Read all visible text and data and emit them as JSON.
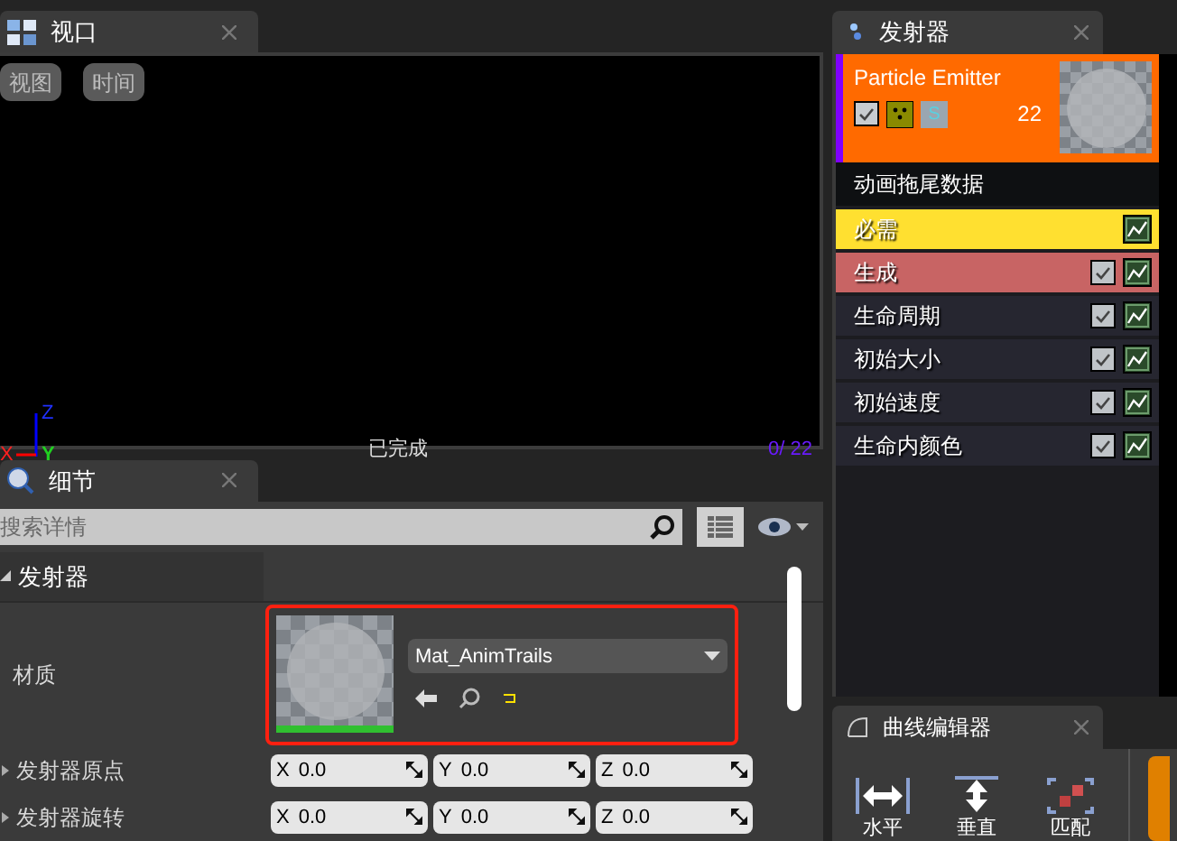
{
  "viewport_tab": {
    "title": "视口"
  },
  "viewport": {
    "buttons": [
      "视图",
      "时间"
    ],
    "axes": {
      "x": "X",
      "y": "Y",
      "z": "Z"
    },
    "status": "已完成",
    "counter": "0/ 22"
  },
  "details_tab": {
    "title": "细节"
  },
  "search": {
    "placeholder": "搜索详情"
  },
  "category": "发射器",
  "material": {
    "label": "材质",
    "value": "Mat_AnimTrails"
  },
  "vector_rows": [
    {
      "label": "发射器原点",
      "fields": [
        {
          "axis": "X",
          "value": "0.0"
        },
        {
          "axis": "Y",
          "value": "0.0"
        },
        {
          "axis": "Z",
          "value": "0.0"
        }
      ]
    },
    {
      "label": "发射器旋转",
      "fields": [
        {
          "axis": "X",
          "value": "0.0"
        },
        {
          "axis": "Y",
          "value": "0.0"
        },
        {
          "axis": "Z",
          "value": "0.0"
        }
      ]
    }
  ],
  "emitter_tab": {
    "title": "发射器"
  },
  "emitter": {
    "name": "Particle Emitter",
    "enabled": true,
    "solo": "S",
    "count": "22"
  },
  "modules": [
    {
      "label": "动画拖尾数据",
      "kind": "header"
    },
    {
      "label": "必需",
      "kind": "module",
      "color": "#ffe030",
      "checkbox": false
    },
    {
      "label": "生成",
      "kind": "module",
      "color": "#c86464",
      "checkbox": true,
      "checked": true
    },
    {
      "label": "生命周期",
      "kind": "module",
      "color": "#262630",
      "checkbox": true,
      "checked": true
    },
    {
      "label": "初始大小",
      "kind": "module",
      "color": "#262630",
      "checkbox": true,
      "checked": true
    },
    {
      "label": "初始速度",
      "kind": "module",
      "color": "#262630",
      "checkbox": true,
      "checked": true
    },
    {
      "label": "生命内颜色",
      "kind": "module",
      "color": "#262630",
      "checkbox": true,
      "checked": true
    }
  ],
  "curve_editor": {
    "title": "曲线编辑器",
    "tools": [
      "水平",
      "垂直",
      "匹配"
    ]
  }
}
